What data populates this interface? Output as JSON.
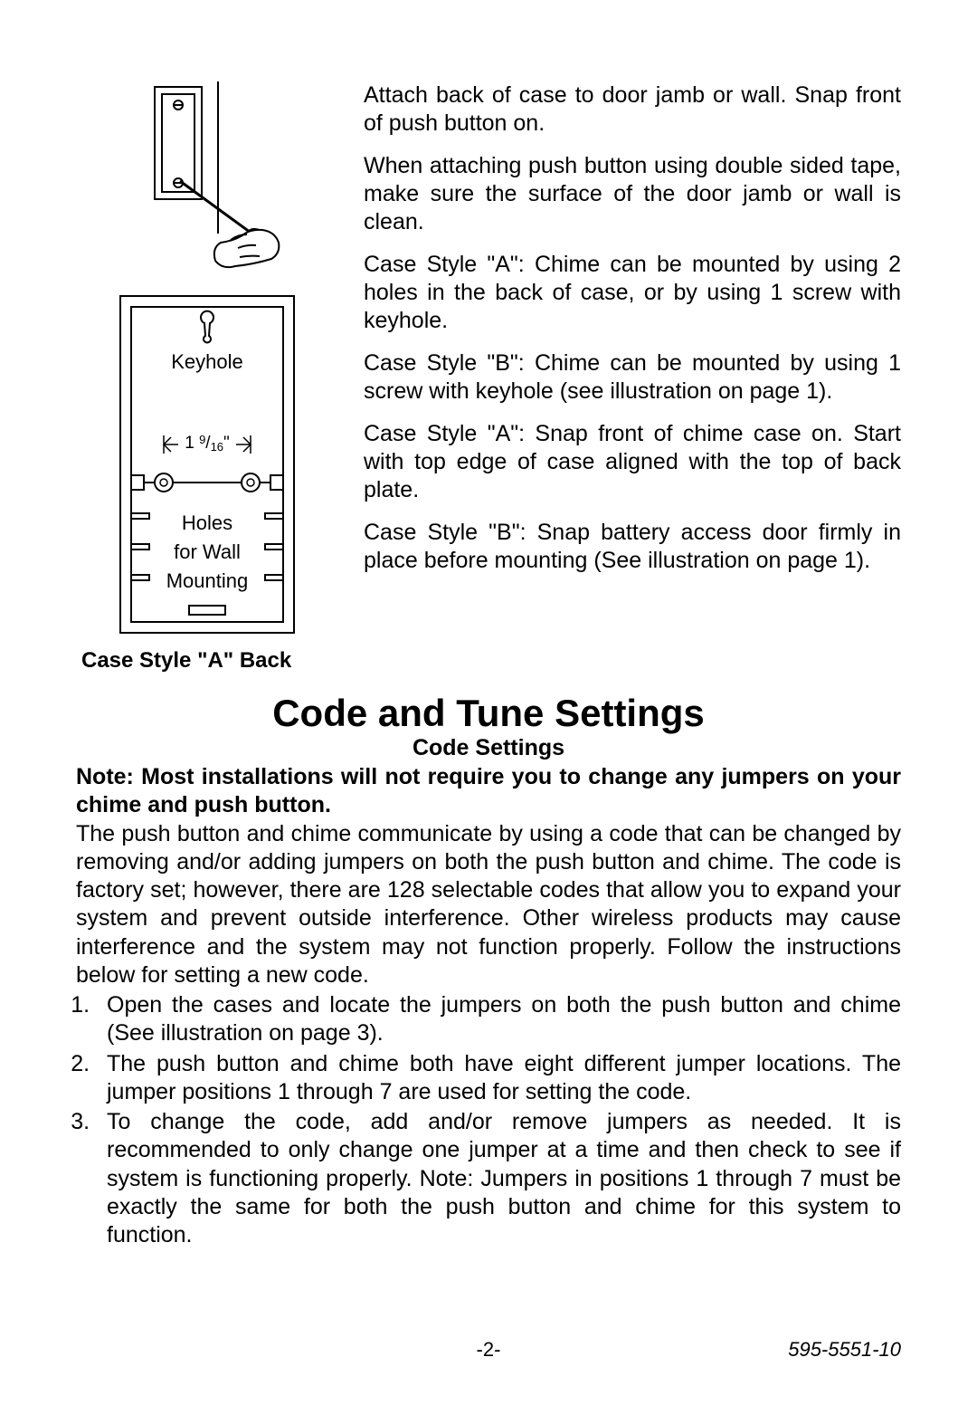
{
  "topInstructions": {
    "p1": "Attach back of case to door jamb or wall. Snap front of push button on.",
    "p2": "When attaching push button using double sided tape, make sure the surface of the door jamb or wall is clean.",
    "p3": "Case Style \"A\": Chime can be mounted by using 2 holes in the back of case, or by using 1 screw with keyhole.",
    "p4": "Case Style \"B\": Chime can be mounted by using 1 screw with keyhole (see illustration on page 1).",
    "p5": "Case Style \"A\": Snap front of chime case on. Start with top edge of case aligned with the top of back plate.",
    "p6": "Case Style \"B\": Snap battery access door firmly in place before mounting (See illustration on page 1)."
  },
  "diagrams": {
    "keyholeLabel": "Keyhole",
    "dimension": "1 9/16\"",
    "holesLine1": "Holes",
    "holesLine2": "for Wall",
    "holesLine3": "Mounting",
    "caption": "Case Style \"A\" Back"
  },
  "code": {
    "heading": "Code and Tune Settings",
    "subheading": "Code Settings",
    "note": "Note: Most installations will not require you to change any jumpers on your chime and push button.",
    "body": "The push button and chime communicate by using a code that can be changed by removing and/or adding jumpers on both the push button and chime. The code is factory set; however, there are 128 selectable codes that allow you to expand your system and prevent outside interference. Other wireless products may cause interference and the system may not function properly. Follow the instructions below for setting a new code.",
    "steps": [
      "Open the cases and locate the jumpers on both the push button and chime (See illustration on page 3).",
      "The push button and chime both have eight different jumper locations. The jumper positions 1 through 7 are used for setting the code.",
      "To change the code, add and/or remove jumpers as needed. It is recommended to only change one jumper at a time and then check to see if system is functioning properly. Note: Jumpers in positions 1 through 7 must be exactly the same for both the push button and chime for this system to function."
    ]
  },
  "footer": {
    "page": "-2-",
    "doc": "595-5551-10"
  }
}
